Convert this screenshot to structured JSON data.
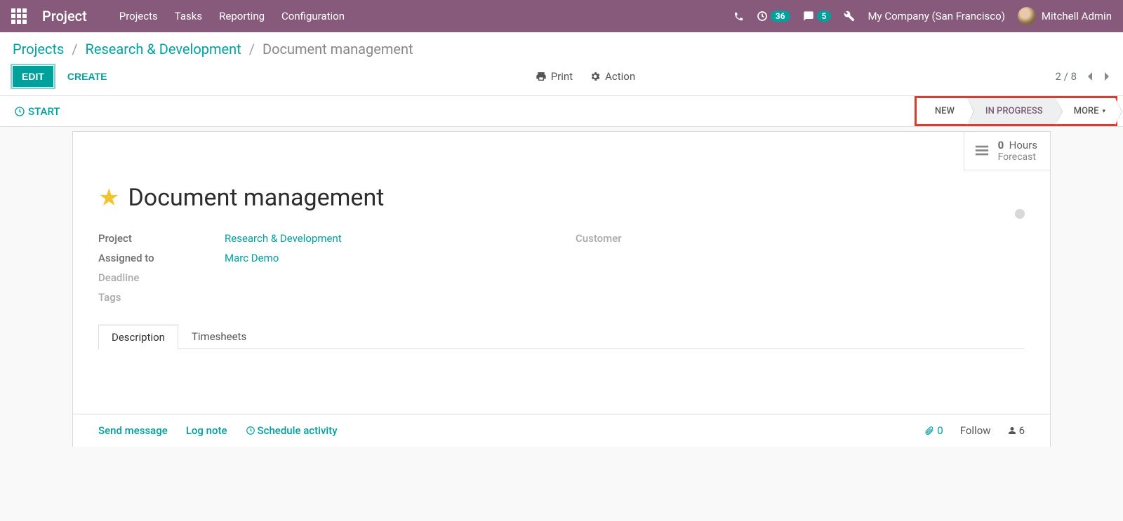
{
  "navbar": {
    "app_title": "Project",
    "menu": [
      "Projects",
      "Tasks",
      "Reporting",
      "Configuration"
    ],
    "activity_count": "36",
    "message_count": "5",
    "company": "My Company (San Francisco)",
    "user": "Mitchell Admin"
  },
  "breadcrumb": {
    "root": "Projects",
    "project": "Research & Development",
    "current": "Document management"
  },
  "buttons": {
    "edit": "EDIT",
    "create": "CREATE",
    "print": "Print",
    "action": "Action",
    "start": "START"
  },
  "pager": {
    "current": "2",
    "sep": "/",
    "total": "8"
  },
  "statusbar": {
    "new": "NEW",
    "in_progress": "IN PROGRESS",
    "more": "MORE"
  },
  "stat": {
    "hours_value": "0",
    "hours_unit": "Hours",
    "forecast": "Forecast"
  },
  "task": {
    "title": "Document management",
    "labels": {
      "project": "Project",
      "assigned": "Assigned to",
      "deadline": "Deadline",
      "tags": "Tags",
      "customer": "Customer"
    },
    "project_value": "Research & Development",
    "assigned_value": "Marc Demo"
  },
  "tabs": {
    "description": "Description",
    "timesheets": "Timesheets"
  },
  "chatter": {
    "send": "Send message",
    "log": "Log note",
    "schedule": "Schedule activity",
    "attachments": "0",
    "follow": "Follow",
    "followers": "6"
  }
}
